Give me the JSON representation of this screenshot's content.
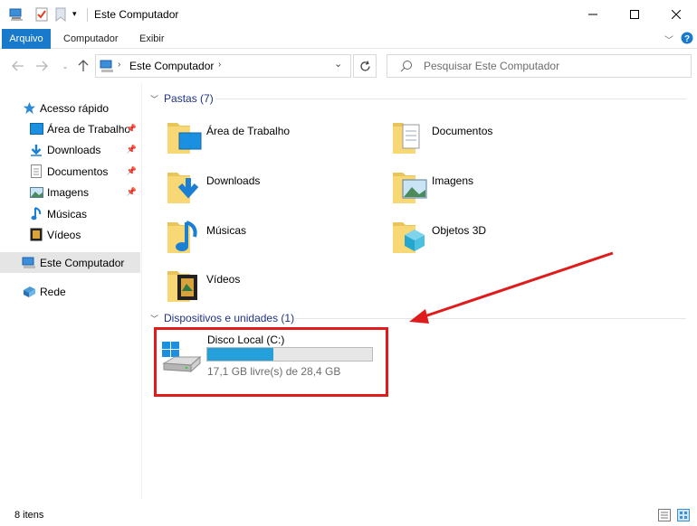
{
  "titlebar": {
    "title": "Este Computador",
    "buttons": [
      "minimize",
      "maximize",
      "close"
    ]
  },
  "ribbon": {
    "tabs": [
      "Arquivo",
      "Computador",
      "Exibir"
    ]
  },
  "navbar": {
    "address": "Este Computador",
    "search_placeholder": "Pesquisar Este Computador"
  },
  "sidebar": {
    "quick_access": "Acesso rápido",
    "items": [
      {
        "label": "Área de Trabalho",
        "icon": "desktop-icon",
        "pinned": true
      },
      {
        "label": "Downloads",
        "icon": "download-icon",
        "pinned": true
      },
      {
        "label": "Documentos",
        "icon": "document-icon",
        "pinned": true
      },
      {
        "label": "Imagens",
        "icon": "image-icon",
        "pinned": true
      },
      {
        "label": "Músicas",
        "icon": "music-icon",
        "pinned": false
      },
      {
        "label": "Vídeos",
        "icon": "video-icon",
        "pinned": false
      }
    ],
    "this_pc": "Este Computador",
    "network": "Rede"
  },
  "main": {
    "folders_header": "Pastas (7)",
    "folders": [
      {
        "label": "Área de Trabalho",
        "icon": "desktop-folder-icon"
      },
      {
        "label": "Documentos",
        "icon": "documents-folder-icon"
      },
      {
        "label": "Downloads",
        "icon": "downloads-folder-icon"
      },
      {
        "label": "Imagens",
        "icon": "pictures-folder-icon"
      },
      {
        "label": "Músicas",
        "icon": "music-folder-icon"
      },
      {
        "label": "Objetos 3D",
        "icon": "3d-objects-folder-icon"
      },
      {
        "label": "Vídeos",
        "icon": "videos-folder-icon"
      }
    ],
    "devices_header": "Dispositivos e unidades (1)",
    "drive": {
      "name": "Disco Local (C:)",
      "info": "17,1 GB livre(s) de 28,4 GB",
      "used_fraction": 0.4
    }
  },
  "statusbar": {
    "count": "8 itens"
  },
  "colors": {
    "accent": "#1979ca",
    "link": "#1e3287",
    "drive_fill": "#26a0da",
    "annotation": "#e01b1b"
  }
}
